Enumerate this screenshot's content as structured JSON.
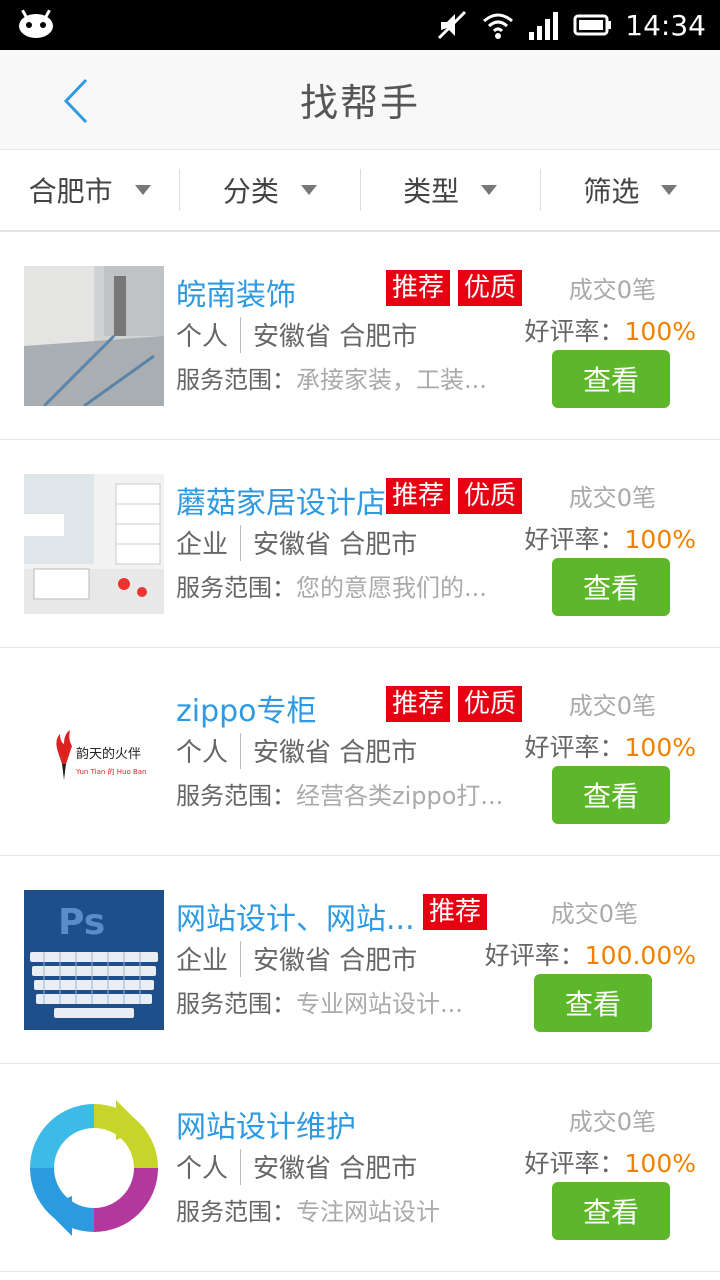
{
  "status_bar": {
    "time": "14:34"
  },
  "header": {
    "title": "找帮手"
  },
  "filters": [
    {
      "label": "合肥市"
    },
    {
      "label": "分类"
    },
    {
      "label": "类型"
    },
    {
      "label": "筛选"
    }
  ],
  "items": [
    {
      "name": "皖南装饰",
      "tags": [
        "推荐",
        "优质"
      ],
      "type": "个人",
      "location": "安徽省 合肥市",
      "scope_label": "服务范围：",
      "scope_desc": "承接家装，工装...",
      "deals": "成交0笔",
      "rating_label": "好评率：",
      "rating_value": "100%",
      "button": "查看"
    },
    {
      "name": "蘑菇家居设计店",
      "tags": [
        "推荐",
        "优质"
      ],
      "type": "企业",
      "location": "安徽省 合肥市",
      "scope_label": "服务范围：",
      "scope_desc": "您的意愿我们的...",
      "deals": "成交0笔",
      "rating_label": "好评率：",
      "rating_value": "100%",
      "button": "查看"
    },
    {
      "name": "zippo专柜",
      "tags": [
        "推荐",
        "优质"
      ],
      "type": "个人",
      "location": "安徽省 合肥市",
      "scope_label": "服务范围：",
      "scope_desc": "经营各类zippo打...",
      "deals": "成交0笔",
      "rating_label": "好评率：",
      "rating_value": "100%",
      "button": "查看",
      "logo_text": "韵天的火伴",
      "logo_sub": "Yun Tian 的 Huo Ban"
    },
    {
      "name": "网站设计、网站...",
      "tags": [
        "推荐"
      ],
      "type": "企业",
      "location": "安徽省 合肥市",
      "scope_label": "服务范围：",
      "scope_desc": "专业网站设计...",
      "deals": "成交0笔",
      "rating_label": "好评率：",
      "rating_value": "100.00%",
      "button": "查看"
    },
    {
      "name": "网站设计维护",
      "tags": [],
      "type": "个人",
      "location": "安徽省 合肥市",
      "scope_label": "服务范围：",
      "scope_desc": "专注网站设计",
      "deals": "成交0笔",
      "rating_label": "好评率：",
      "rating_value": "100%",
      "button": "查看"
    }
  ],
  "colors": {
    "accent_blue": "#2f9ae2",
    "tag_red": "#e60012",
    "button_green": "#5cb82a",
    "rating_orange": "#f08000"
  }
}
